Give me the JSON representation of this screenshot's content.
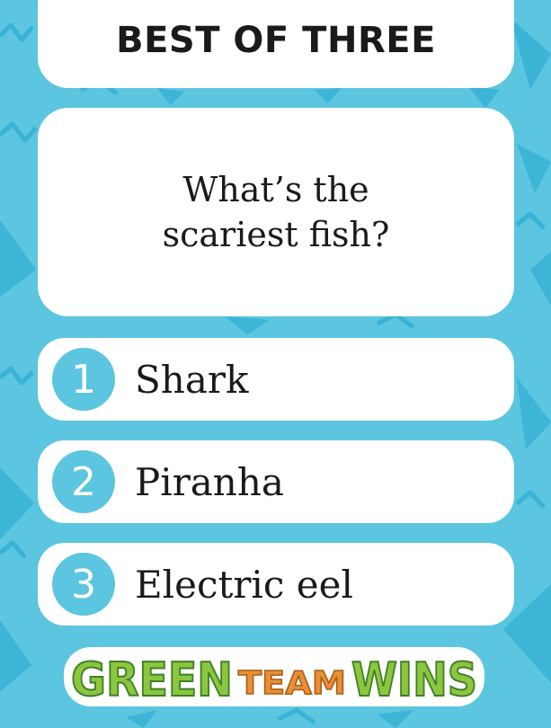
{
  "title": "BEST OF THREE",
  "question": "What’s the scariest fish?",
  "options": [
    {
      "number": "1",
      "label": "Shark"
    },
    {
      "number": "2",
      "label": "Piranha"
    },
    {
      "number": "3",
      "label": "Electric eel"
    }
  ],
  "footer": {
    "word1": "GREEN",
    "word2": "TEAM",
    "word3": "WINS"
  },
  "colors": {
    "background": "#5cc5e0",
    "pattern": "#38b3d5",
    "card": "#ffffff",
    "green": "#8cc63e",
    "orange": "#e98f35"
  }
}
